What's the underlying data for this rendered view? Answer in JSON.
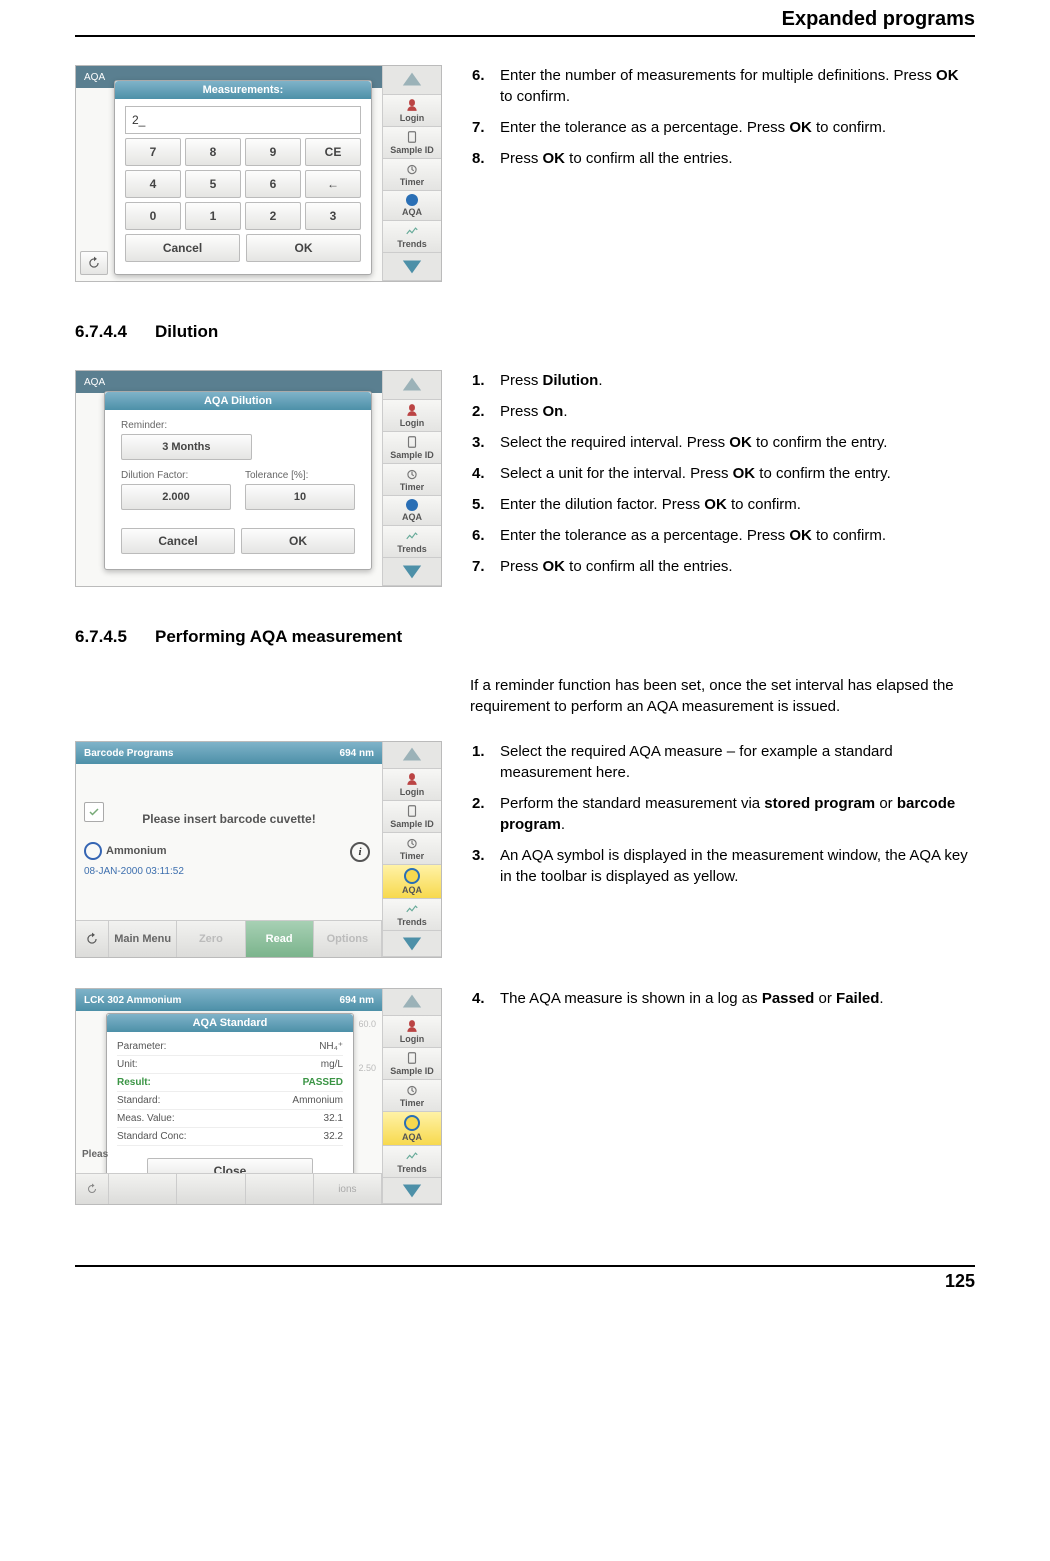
{
  "page": {
    "header": "Expanded programs",
    "number": "125"
  },
  "sections": {
    "s1": {
      "num": "6.7.4.4",
      "title": "Dilution"
    },
    "s2": {
      "num": "6.7.4.5",
      "title": "Performing AQA measurement",
      "intro": "If a reminder function has been set, once the set interval has elapsed the requirement to perform an AQA measurement is issued."
    }
  },
  "steps_block1": [
    {
      "n": "6.",
      "t_pre": "Enter the number of measurements for multiple definitions. Press ",
      "b": "OK",
      "t_post": " to confirm."
    },
    {
      "n": "7.",
      "t_pre": "Enter the tolerance as a percentage. Press ",
      "b": "OK",
      "t_post": " to confirm."
    },
    {
      "n": "8.",
      "t_pre": "Press ",
      "b": "OK",
      "t_post": " to confirm all the entries."
    }
  ],
  "steps_block2": [
    {
      "n": "1.",
      "t_pre": "Press ",
      "b": "Dilution",
      "t_post": "."
    },
    {
      "n": "2.",
      "t_pre": "Press ",
      "b": "On",
      "t_post": "."
    },
    {
      "n": "3.",
      "t_pre": "Select the required interval. Press ",
      "b": "OK",
      "t_post": " to confirm the entry."
    },
    {
      "n": "4.",
      "t_pre": "Select a unit for the interval. Press ",
      "b": "OK",
      "t_post": " to confirm the entry."
    },
    {
      "n": "5.",
      "t_pre": "Enter the dilution factor. Press ",
      "b": "OK",
      "t_post": " to confirm."
    },
    {
      "n": "6.",
      "t_pre": "Enter the tolerance as a percentage. Press ",
      "b": "OK",
      "t_post": " to confirm."
    },
    {
      "n": "7.",
      "t_pre": "Press ",
      "b": "OK",
      "t_post": " to confirm all the entries."
    }
  ],
  "steps_block3": [
    {
      "n": "1.",
      "html": "Select the required AQA measure – for example a standard measurement here."
    },
    {
      "n": "2.",
      "html": "Perform the standard measurement via <b>stored program</b> or <b>barcode program</b>."
    },
    {
      "n": "3.",
      "html": "An AQA symbol is displayed in the measurement window, the AQA key in the toolbar is displayed as yellow."
    }
  ],
  "steps_block4": [
    {
      "n": "4.",
      "html": "The AQA measure is shown in a log as <b>Passed</b> or <b>Failed</b>."
    }
  ],
  "toolbar": {
    "login": "Login",
    "sampleid": "Sample ID",
    "timer": "Timer",
    "aqa": "AQA",
    "trends": "Trends"
  },
  "shot1": {
    "header_bg": "AQA",
    "dialog_title": "Measurements:",
    "value": "2_",
    "keys": [
      "7",
      "8",
      "9",
      "CE",
      "4",
      "5",
      "6",
      "←",
      "0",
      "1",
      "2",
      "3"
    ],
    "cancel": "Cancel",
    "ok": "OK"
  },
  "shot2": {
    "dialog_title": "AQA Dilution",
    "reminder_label": "Reminder:",
    "reminder_value": "3 Months",
    "df_label": "Dilution Factor:",
    "df_value": "2.000",
    "tol_label": "Tolerance [%]:",
    "tol_value": "10",
    "cancel": "Cancel",
    "ok": "OK"
  },
  "shot3": {
    "title": "Barcode Programs",
    "nm": "694 nm",
    "msg": "Please insert barcode cuvette!",
    "ammon": "Ammonium",
    "date": "08-JAN-2000  03:11:52",
    "main_menu": "Main Menu",
    "zero": "Zero",
    "read": "Read",
    "options": "Options"
  },
  "shot4": {
    "top_left": "LCK 302 Ammonium",
    "top_right": "694 nm",
    "dialog_title": "AQA Standard",
    "rows": [
      {
        "k": "Parameter:",
        "v": "NH₄⁺"
      },
      {
        "k": "Unit:",
        "v": "mg/L"
      },
      {
        "k": "Result:",
        "v": "PASSED",
        "green": true
      },
      {
        "k": "Standard:",
        "v": "Ammonium"
      },
      {
        "k": "Meas. Value:",
        "v": "32.1"
      },
      {
        "k": "Standard Conc:",
        "v": "32.2"
      }
    ],
    "close": "Close",
    "bg_vals": [
      "60.0",
      "2.50"
    ],
    "pleas": "Pleas",
    "options": "ions"
  }
}
